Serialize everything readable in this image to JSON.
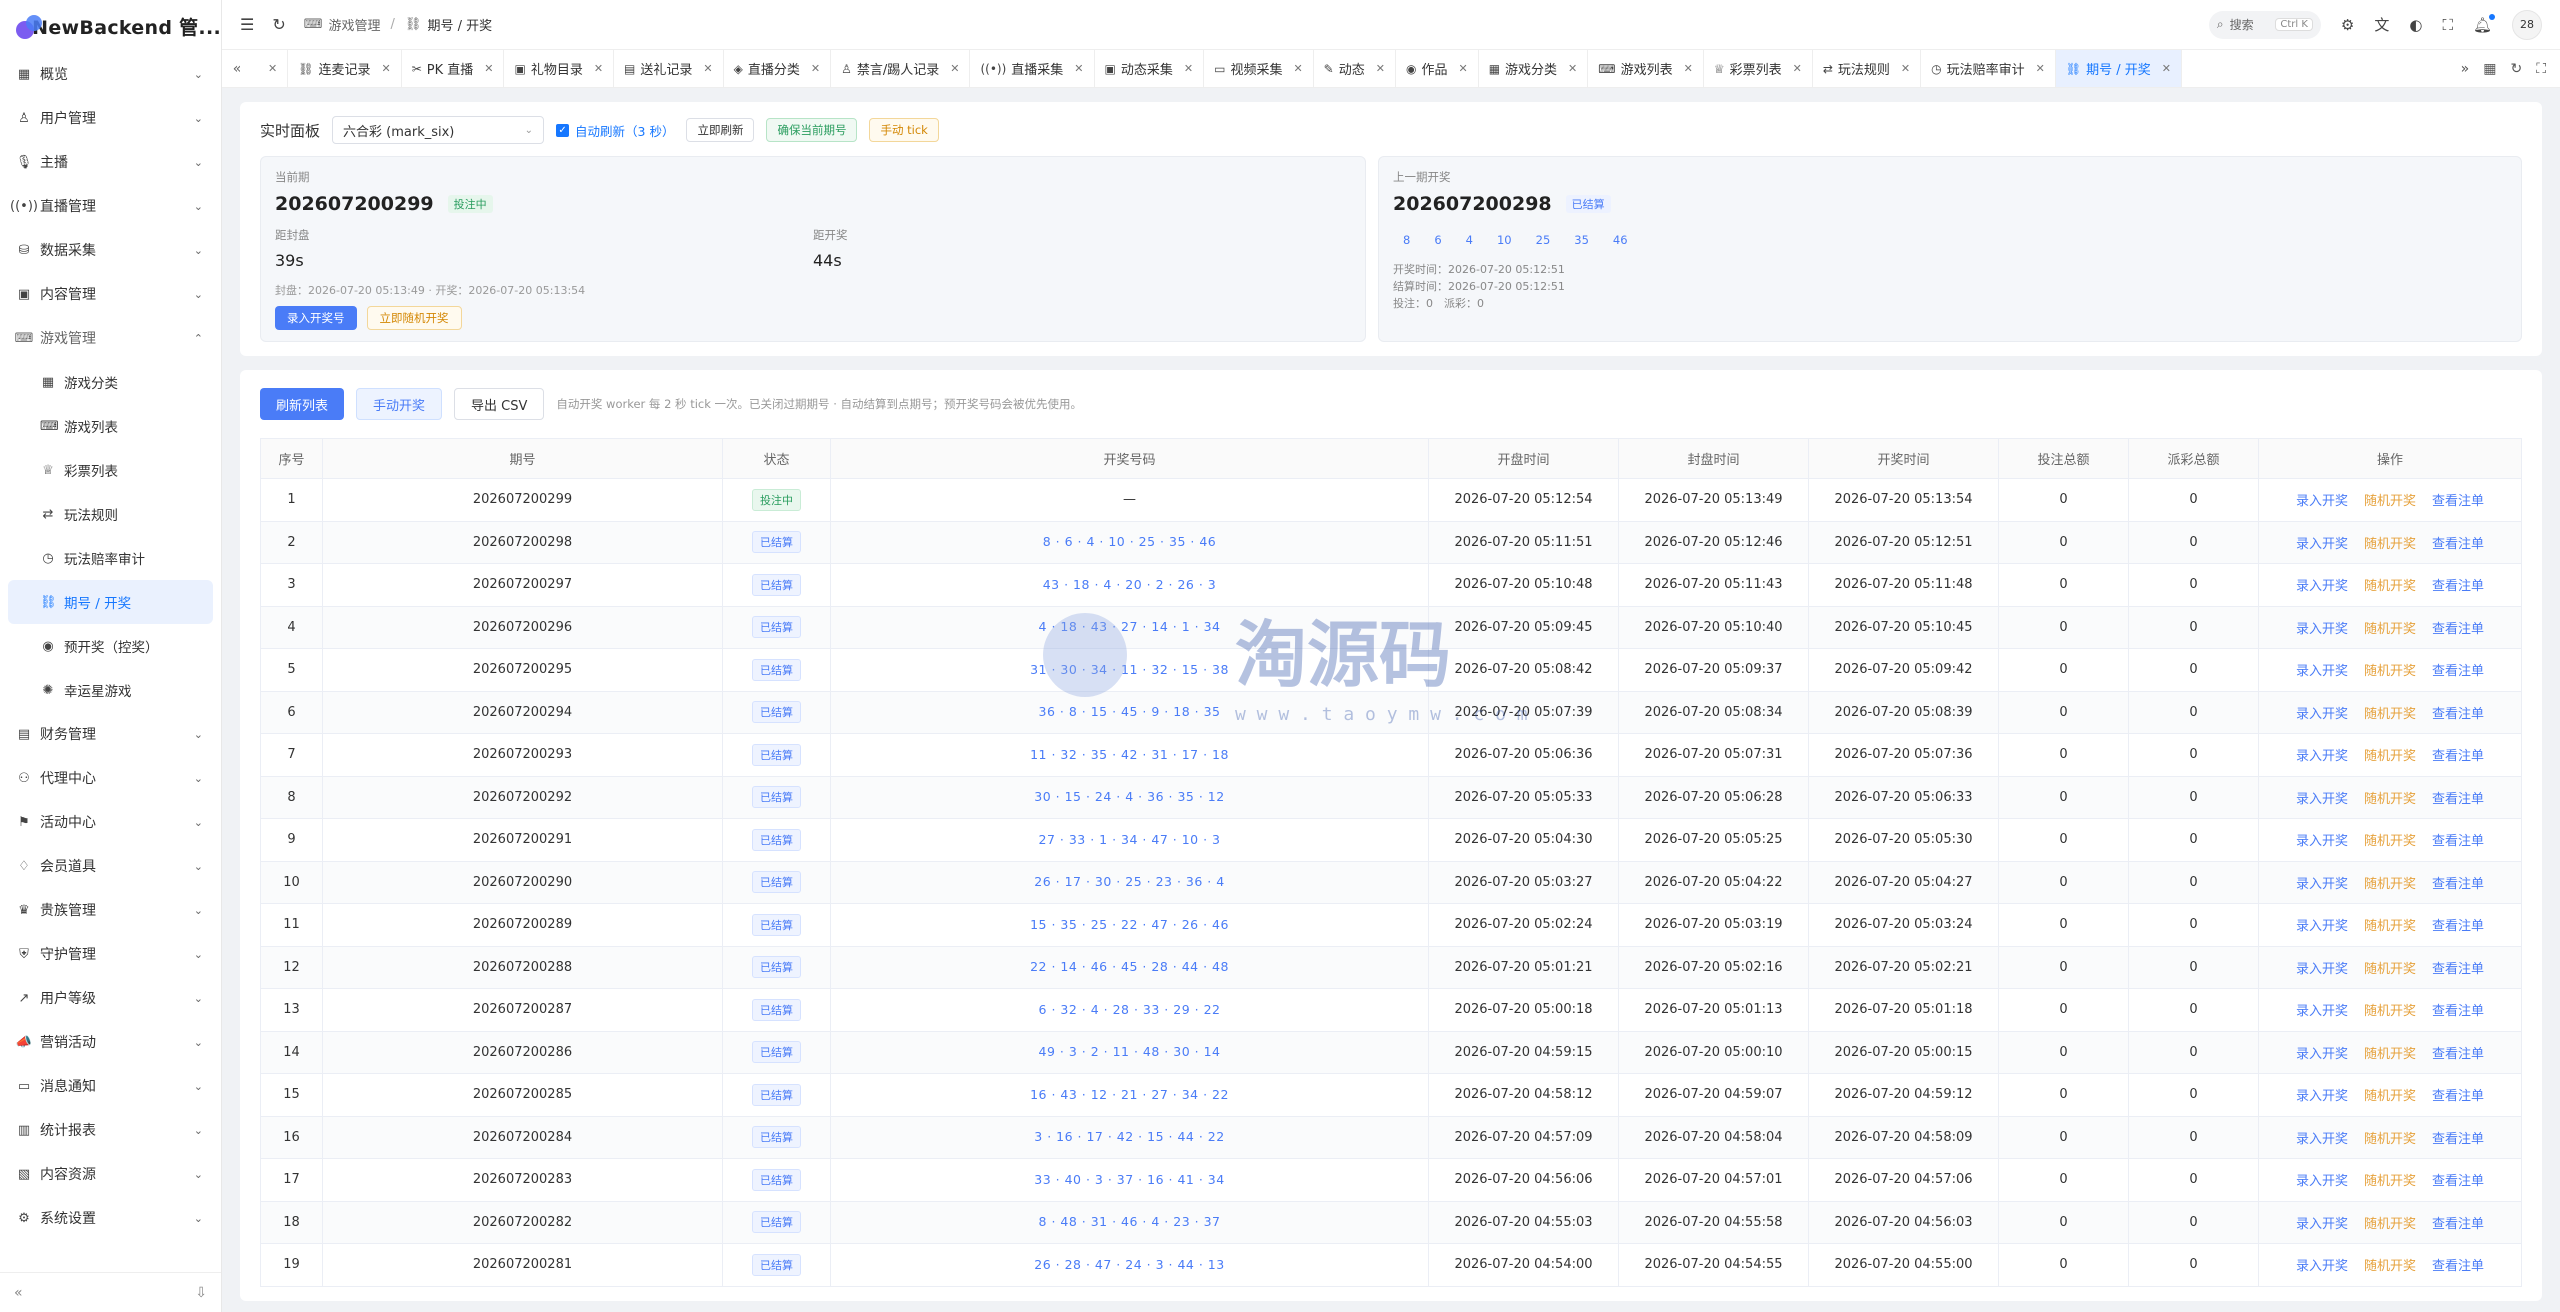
{
  "app": {
    "title": "NewBackend 管..."
  },
  "sidebar": {
    "menu": [
      {
        "label": "概览",
        "icon": "grid-icon",
        "glyph": "▦",
        "open": false
      },
      {
        "label": "用户管理",
        "icon": "user-icon",
        "glyph": "♙",
        "open": false
      },
      {
        "label": "主播",
        "icon": "mic-icon",
        "glyph": "🎙",
        "open": false
      },
      {
        "label": "直播管理",
        "icon": "broadcast-icon",
        "glyph": "((•))",
        "open": false
      },
      {
        "label": "数据采集",
        "icon": "database-icon",
        "glyph": "⛁",
        "open": false
      },
      {
        "label": "内容管理",
        "icon": "folder-icon",
        "glyph": "▣",
        "open": false
      },
      {
        "label": "游戏管理",
        "icon": "gamepad-icon",
        "glyph": "⌨",
        "open": true
      }
    ],
    "submenu": [
      {
        "label": "游戏分类",
        "glyph": "▦",
        "icon": "grid-icon"
      },
      {
        "label": "游戏列表",
        "glyph": "⌨",
        "icon": "gamepad-icon"
      },
      {
        "label": "彩票列表",
        "glyph": "♕",
        "icon": "trophy-icon"
      },
      {
        "label": "玩法规则",
        "glyph": "⇄",
        "icon": "swap-icon"
      },
      {
        "label": "玩法赔率审计",
        "glyph": "◷",
        "icon": "history-icon"
      },
      {
        "label": "期号 / 开奖",
        "glyph": "⛓",
        "icon": "link-icon",
        "active": true
      },
      {
        "label": "预开奖（控奖）",
        "glyph": "◉",
        "icon": "target-icon"
      },
      {
        "label": "幸运星游戏",
        "glyph": "✺",
        "icon": "star-icon"
      }
    ],
    "menu2": [
      {
        "label": "财务管理",
        "glyph": "▤",
        "icon": "finance-icon"
      },
      {
        "label": "代理中心",
        "glyph": "⚇",
        "icon": "agent-icon"
      },
      {
        "label": "活动中心",
        "glyph": "⚑",
        "icon": "activity-icon"
      },
      {
        "label": "会员道具",
        "glyph": "♢",
        "icon": "gem-icon"
      },
      {
        "label": "贵族管理",
        "glyph": "♛",
        "icon": "crown-icon"
      },
      {
        "label": "守护管理",
        "glyph": "⛨",
        "icon": "shield-icon"
      },
      {
        "label": "用户等级",
        "glyph": "↗",
        "icon": "trend-icon"
      },
      {
        "label": "营销活动",
        "glyph": "📣",
        "icon": "megaphone-icon"
      },
      {
        "label": "消息通知",
        "glyph": "▭",
        "icon": "message-icon"
      },
      {
        "label": "统计报表",
        "glyph": "▥",
        "icon": "chart-icon"
      },
      {
        "label": "内容资源",
        "glyph": "▧",
        "icon": "resource-icon"
      },
      {
        "label": "系统设置",
        "glyph": "⚙",
        "icon": "settings-icon"
      }
    ]
  },
  "topbar": {
    "crumb1": "游戏管理",
    "crumb2": "期号 / 开奖",
    "search_label": "搜索",
    "search_kbd": "Ctrl K",
    "avatar": "28"
  },
  "tabs": [
    {
      "label": "",
      "icon": ""
    },
    {
      "label": "连麦记录",
      "glyph": "⛓"
    },
    {
      "label": "PK 直播",
      "glyph": "✂"
    },
    {
      "label": "礼物目录",
      "glyph": "▣"
    },
    {
      "label": "送礼记录",
      "glyph": "▤"
    },
    {
      "label": "直播分类",
      "glyph": "◈"
    },
    {
      "label": "禁言/踢人记录",
      "glyph": "♙"
    },
    {
      "label": "直播采集",
      "glyph": "((•))"
    },
    {
      "label": "动态采集",
      "glyph": "▣"
    },
    {
      "label": "视频采集",
      "glyph": "▭"
    },
    {
      "label": "动态",
      "glyph": "✎"
    },
    {
      "label": "作品",
      "glyph": "◉"
    },
    {
      "label": "游戏分类",
      "glyph": "▦"
    },
    {
      "label": "游戏列表",
      "glyph": "⌨"
    },
    {
      "label": "彩票列表",
      "glyph": "♕"
    },
    {
      "label": "玩法规则",
      "glyph": "⇄"
    },
    {
      "label": "玩法赔率审计",
      "glyph": "◷"
    },
    {
      "label": "期号 / 开奖",
      "glyph": "⛓",
      "active": true
    }
  ],
  "panel": {
    "title": "实时面板",
    "select_value": "六合彩 (mark_six)",
    "auto_refresh": "自动刷新（3 秒）",
    "btn_refresh": "立即刷新",
    "btn_ensure": "确保当前期号",
    "btn_tick": "手动 tick",
    "current": {
      "label": "当前期",
      "issue": "202607200299",
      "status": "投注中",
      "close_label": "距封盘",
      "close_value": "39s",
      "draw_label": "距开奖",
      "draw_value": "44s",
      "times": "封盘：2026-07-20 05:13:49 · 开奖：2026-07-20 05:13:54",
      "btn_input": "录入开奖号",
      "btn_random": "立即随机开奖"
    },
    "last": {
      "label": "上一期开奖",
      "issue": "202607200298",
      "status": "已结算",
      "balls": [
        "8",
        "6",
        "4",
        "10",
        "25",
        "35",
        "46"
      ],
      "draw_time": "开奖时间：2026-07-20 05:12:51",
      "settle_time": "结算时间：2026-07-20 05:12:51",
      "bets": "投注：0　派彩：0"
    }
  },
  "list": {
    "btn_refresh": "刷新列表",
    "btn_manual": "手动开奖",
    "btn_export": "导出 CSV",
    "hint": "自动开奖 worker 每 2 秒 tick 一次。已关闭过期期号 · 自动结算到点期号；预开奖号码会被优先使用。",
    "headers": [
      "序号",
      "期号",
      "状态",
      "开奖号码",
      "开盘时间",
      "封盘时间",
      "开奖时间",
      "投注总额",
      "派彩总额",
      "操作"
    ],
    "op1": "录入开奖",
    "op2": "随机开奖",
    "op3": "查看注单",
    "rows": [
      {
        "no": "1",
        "issue": "202607200299",
        "status": "投注中",
        "nums": "—",
        "open": "2026-07-20 05:12:54",
        "close": "2026-07-20 05:13:49",
        "draw": "2026-07-20 05:13:54",
        "bet": "0",
        "pay": "0"
      },
      {
        "no": "2",
        "issue": "202607200298",
        "status": "已结算",
        "nums": "8 · 6 · 4 · 10 · 25 · 35 · 46",
        "open": "2026-07-20 05:11:51",
        "close": "2026-07-20 05:12:46",
        "draw": "2026-07-20 05:12:51",
        "bet": "0",
        "pay": "0"
      },
      {
        "no": "3",
        "issue": "202607200297",
        "status": "已结算",
        "nums": "43 · 18 · 4 · 20 · 2 · 26 · 3",
        "open": "2026-07-20 05:10:48",
        "close": "2026-07-20 05:11:43",
        "draw": "2026-07-20 05:11:48",
        "bet": "0",
        "pay": "0"
      },
      {
        "no": "4",
        "issue": "202607200296",
        "status": "已结算",
        "nums": "4 · 18 · 43 · 27 · 14 · 1 · 34",
        "open": "2026-07-20 05:09:45",
        "close": "2026-07-20 05:10:40",
        "draw": "2026-07-20 05:10:45",
        "bet": "0",
        "pay": "0"
      },
      {
        "no": "5",
        "issue": "202607200295",
        "status": "已结算",
        "nums": "31 · 30 · 34 · 11 · 32 · 15 · 38",
        "open": "2026-07-20 05:08:42",
        "close": "2026-07-20 05:09:37",
        "draw": "2026-07-20 05:09:42",
        "bet": "0",
        "pay": "0"
      },
      {
        "no": "6",
        "issue": "202607200294",
        "status": "已结算",
        "nums": "36 · 8 · 15 · 45 · 9 · 18 · 35",
        "open": "2026-07-20 05:07:39",
        "close": "2026-07-20 05:08:34",
        "draw": "2026-07-20 05:08:39",
        "bet": "0",
        "pay": "0"
      },
      {
        "no": "7",
        "issue": "202607200293",
        "status": "已结算",
        "nums": "11 · 32 · 35 · 42 · 31 · 17 · 18",
        "open": "2026-07-20 05:06:36",
        "close": "2026-07-20 05:07:31",
        "draw": "2026-07-20 05:07:36",
        "bet": "0",
        "pay": "0"
      },
      {
        "no": "8",
        "issue": "202607200292",
        "status": "已结算",
        "nums": "30 · 15 · 24 · 4 · 36 · 35 · 12",
        "open": "2026-07-20 05:05:33",
        "close": "2026-07-20 05:06:28",
        "draw": "2026-07-20 05:06:33",
        "bet": "0",
        "pay": "0"
      },
      {
        "no": "9",
        "issue": "202607200291",
        "status": "已结算",
        "nums": "27 · 33 · 1 · 34 · 47 · 10 · 3",
        "open": "2026-07-20 05:04:30",
        "close": "2026-07-20 05:05:25",
        "draw": "2026-07-20 05:05:30",
        "bet": "0",
        "pay": "0"
      },
      {
        "no": "10",
        "issue": "202607200290",
        "status": "已结算",
        "nums": "26 · 17 · 30 · 25 · 23 · 36 · 4",
        "open": "2026-07-20 05:03:27",
        "close": "2026-07-20 05:04:22",
        "draw": "2026-07-20 05:04:27",
        "bet": "0",
        "pay": "0"
      },
      {
        "no": "11",
        "issue": "202607200289",
        "status": "已结算",
        "nums": "15 · 35 · 25 · 22 · 47 · 26 · 46",
        "open": "2026-07-20 05:02:24",
        "close": "2026-07-20 05:03:19",
        "draw": "2026-07-20 05:03:24",
        "bet": "0",
        "pay": "0"
      },
      {
        "no": "12",
        "issue": "202607200288",
        "status": "已结算",
        "nums": "22 · 14 · 46 · 45 · 28 · 44 · 48",
        "open": "2026-07-20 05:01:21",
        "close": "2026-07-20 05:02:16",
        "draw": "2026-07-20 05:02:21",
        "bet": "0",
        "pay": "0"
      },
      {
        "no": "13",
        "issue": "202607200287",
        "status": "已结算",
        "nums": "6 · 32 · 4 · 28 · 33 · 29 · 22",
        "open": "2026-07-20 05:00:18",
        "close": "2026-07-20 05:01:13",
        "draw": "2026-07-20 05:01:18",
        "bet": "0",
        "pay": "0"
      },
      {
        "no": "14",
        "issue": "202607200286",
        "status": "已结算",
        "nums": "49 · 3 · 2 · 11 · 48 · 30 · 14",
        "open": "2026-07-20 04:59:15",
        "close": "2026-07-20 05:00:10",
        "draw": "2026-07-20 05:00:15",
        "bet": "0",
        "pay": "0"
      },
      {
        "no": "15",
        "issue": "202607200285",
        "status": "已结算",
        "nums": "16 · 43 · 12 · 21 · 27 · 34 · 22",
        "open": "2026-07-20 04:58:12",
        "close": "2026-07-20 04:59:07",
        "draw": "2026-07-20 04:59:12",
        "bet": "0",
        "pay": "0"
      },
      {
        "no": "16",
        "issue": "202607200284",
        "status": "已结算",
        "nums": "3 · 16 · 17 · 42 · 15 · 44 · 22",
        "open": "2026-07-20 04:57:09",
        "close": "2026-07-20 04:58:04",
        "draw": "2026-07-20 04:58:09",
        "bet": "0",
        "pay": "0"
      },
      {
        "no": "17",
        "issue": "202607200283",
        "status": "已结算",
        "nums": "33 · 40 · 3 · 37 · 16 · 41 · 34",
        "open": "2026-07-20 04:56:06",
        "close": "2026-07-20 04:57:01",
        "draw": "2026-07-20 04:57:06",
        "bet": "0",
        "pay": "0"
      },
      {
        "no": "18",
        "issue": "202607200282",
        "status": "已结算",
        "nums": "8 · 48 · 31 · 46 · 4 · 23 · 37",
        "open": "2026-07-20 04:55:03",
        "close": "2026-07-20 04:55:58",
        "draw": "2026-07-20 04:56:03",
        "bet": "0",
        "pay": "0"
      },
      {
        "no": "19",
        "issue": "202607200281",
        "status": "已结算",
        "nums": "26 · 28 · 47 · 24 · 3 · 44 · 13",
        "open": "2026-07-20 04:54:00",
        "close": "2026-07-20 04:54:55",
        "draw": "2026-07-20 04:55:00",
        "bet": "0",
        "pay": "0"
      }
    ]
  },
  "watermark": {
    "text": "淘源码",
    "url": "w w w . t a o y m w . c o m"
  },
  "colors": {
    "accent": "#4a7cf7",
    "warn": "#e6a23c",
    "success": "#2a9d5f"
  }
}
